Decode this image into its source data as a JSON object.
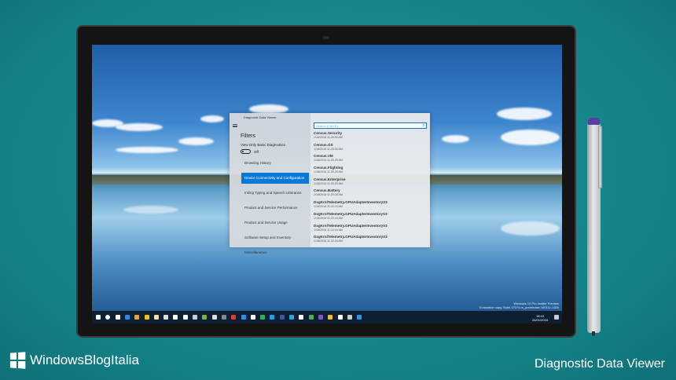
{
  "app": {
    "title": "Diagnostic Data Viewer",
    "filters_heading": "Filters",
    "basic_toggle_label": "View Only Basic Diagnostics",
    "basic_toggle_state": "Off",
    "categories": [
      {
        "label": "Browsing History",
        "selected": false
      },
      {
        "label": "Device Connectivity and Configuration",
        "selected": true
      },
      {
        "label": "Inking Typing and Speech Utterance",
        "selected": false
      },
      {
        "label": "Product and Service Performance",
        "selected": false
      },
      {
        "label": "Product and Service Usage",
        "selected": false
      },
      {
        "label": "Software Setup and Inventory",
        "selected": false
      },
      {
        "label": "Miscellaneous",
        "selected": false
      }
    ],
    "search_placeholder": "Search (Ctrl+E)",
    "events": [
      {
        "name": "Census.Security",
        "time": "1/18/2018 11:25:30 AM"
      },
      {
        "name": "Census.OS",
        "time": "1/18/2018 11:25:30 AM"
      },
      {
        "name": "Census.VM",
        "time": "1/18/2018 11:25:29 AM"
      },
      {
        "name": "Census.Flighting",
        "time": "1/18/2018 11:25:29 AM"
      },
      {
        "name": "Census.Enterprise",
        "time": "1/18/2018 11:25:29 AM"
      },
      {
        "name": "Census.Battery",
        "time": "1/18/2018 11:25:28 AM"
      },
      {
        "name": "DxgKrnlTelemetry.GPUAdapterInventoryV2",
        "time": "1/18/2018 11:22:24 AM"
      },
      {
        "name": "DxgKrnlTelemetry.GPUAdapterInventoryV2",
        "time": "1/18/2018 11:22:24 AM"
      },
      {
        "name": "DxgKrnlTelemetry.GPUAdapterInventoryV2",
        "time": "1/18/2018 11:22:24 AM"
      },
      {
        "name": "DxgKrnlTelemetry.GPUAdapterInventoryV2",
        "time": "1/18/2018 11:22:24 AM"
      }
    ],
    "accent": "#0a78d7"
  },
  "desktop": {
    "watermark_line1": "Windows 10 Pro Insider Preview",
    "watermark_line2": "Evaluation copy. Build 17074.rs_prerelease.180111-1320",
    "clock_time": "18:43",
    "clock_date": "24/01/2018",
    "taskbar_icon_colors": [
      "#ffffff",
      "#ffffff",
      "#ffffff",
      "#2a8ae0",
      "#e8a12a",
      "#f1c40f",
      "#f1e0a0",
      "#dddddd",
      "#ffffff",
      "#ffffff",
      "#cccccc",
      "#7cb342",
      "#dddddd",
      "#888888",
      "#e53935",
      "#2196f3",
      "#ffffff",
      "#1db954",
      "#1da1f2",
      "#3b5998",
      "#2ca5e0",
      "#ffffff",
      "#4caf50",
      "#7e57c2",
      "#f1c40f",
      "#ffffff",
      "#cccccc",
      "#2196f3"
    ]
  },
  "footer": {
    "brand": "WindowsBlogItalia",
    "caption": "Diagnostic Data Viewer"
  }
}
